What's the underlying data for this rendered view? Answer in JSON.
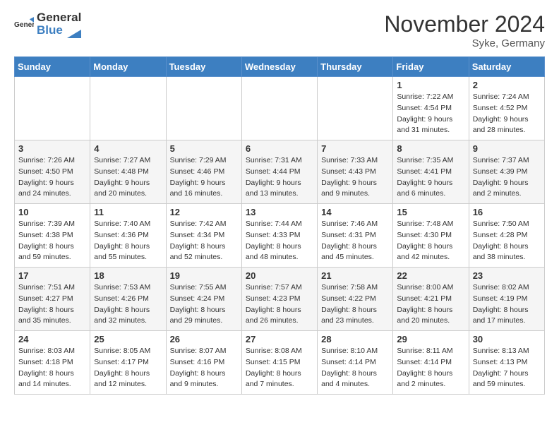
{
  "logo": {
    "general": "General",
    "blue": "Blue"
  },
  "header": {
    "title": "November 2024",
    "subtitle": "Syke, Germany"
  },
  "weekdays": [
    "Sunday",
    "Monday",
    "Tuesday",
    "Wednesday",
    "Thursday",
    "Friday",
    "Saturday"
  ],
  "weeks": [
    [
      {
        "day": "",
        "info": ""
      },
      {
        "day": "",
        "info": ""
      },
      {
        "day": "",
        "info": ""
      },
      {
        "day": "",
        "info": ""
      },
      {
        "day": "",
        "info": ""
      },
      {
        "day": "1",
        "info": "Sunrise: 7:22 AM\nSunset: 4:54 PM\nDaylight: 9 hours and 31 minutes."
      },
      {
        "day": "2",
        "info": "Sunrise: 7:24 AM\nSunset: 4:52 PM\nDaylight: 9 hours and 28 minutes."
      }
    ],
    [
      {
        "day": "3",
        "info": "Sunrise: 7:26 AM\nSunset: 4:50 PM\nDaylight: 9 hours and 24 minutes."
      },
      {
        "day": "4",
        "info": "Sunrise: 7:27 AM\nSunset: 4:48 PM\nDaylight: 9 hours and 20 minutes."
      },
      {
        "day": "5",
        "info": "Sunrise: 7:29 AM\nSunset: 4:46 PM\nDaylight: 9 hours and 16 minutes."
      },
      {
        "day": "6",
        "info": "Sunrise: 7:31 AM\nSunset: 4:44 PM\nDaylight: 9 hours and 13 minutes."
      },
      {
        "day": "7",
        "info": "Sunrise: 7:33 AM\nSunset: 4:43 PM\nDaylight: 9 hours and 9 minutes."
      },
      {
        "day": "8",
        "info": "Sunrise: 7:35 AM\nSunset: 4:41 PM\nDaylight: 9 hours and 6 minutes."
      },
      {
        "day": "9",
        "info": "Sunrise: 7:37 AM\nSunset: 4:39 PM\nDaylight: 9 hours and 2 minutes."
      }
    ],
    [
      {
        "day": "10",
        "info": "Sunrise: 7:39 AM\nSunset: 4:38 PM\nDaylight: 8 hours and 59 minutes."
      },
      {
        "day": "11",
        "info": "Sunrise: 7:40 AM\nSunset: 4:36 PM\nDaylight: 8 hours and 55 minutes."
      },
      {
        "day": "12",
        "info": "Sunrise: 7:42 AM\nSunset: 4:34 PM\nDaylight: 8 hours and 52 minutes."
      },
      {
        "day": "13",
        "info": "Sunrise: 7:44 AM\nSunset: 4:33 PM\nDaylight: 8 hours and 48 minutes."
      },
      {
        "day": "14",
        "info": "Sunrise: 7:46 AM\nSunset: 4:31 PM\nDaylight: 8 hours and 45 minutes."
      },
      {
        "day": "15",
        "info": "Sunrise: 7:48 AM\nSunset: 4:30 PM\nDaylight: 8 hours and 42 minutes."
      },
      {
        "day": "16",
        "info": "Sunrise: 7:50 AM\nSunset: 4:28 PM\nDaylight: 8 hours and 38 minutes."
      }
    ],
    [
      {
        "day": "17",
        "info": "Sunrise: 7:51 AM\nSunset: 4:27 PM\nDaylight: 8 hours and 35 minutes."
      },
      {
        "day": "18",
        "info": "Sunrise: 7:53 AM\nSunset: 4:26 PM\nDaylight: 8 hours and 32 minutes."
      },
      {
        "day": "19",
        "info": "Sunrise: 7:55 AM\nSunset: 4:24 PM\nDaylight: 8 hours and 29 minutes."
      },
      {
        "day": "20",
        "info": "Sunrise: 7:57 AM\nSunset: 4:23 PM\nDaylight: 8 hours and 26 minutes."
      },
      {
        "day": "21",
        "info": "Sunrise: 7:58 AM\nSunset: 4:22 PM\nDaylight: 8 hours and 23 minutes."
      },
      {
        "day": "22",
        "info": "Sunrise: 8:00 AM\nSunset: 4:21 PM\nDaylight: 8 hours and 20 minutes."
      },
      {
        "day": "23",
        "info": "Sunrise: 8:02 AM\nSunset: 4:19 PM\nDaylight: 8 hours and 17 minutes."
      }
    ],
    [
      {
        "day": "24",
        "info": "Sunrise: 8:03 AM\nSunset: 4:18 PM\nDaylight: 8 hours and 14 minutes."
      },
      {
        "day": "25",
        "info": "Sunrise: 8:05 AM\nSunset: 4:17 PM\nDaylight: 8 hours and 12 minutes."
      },
      {
        "day": "26",
        "info": "Sunrise: 8:07 AM\nSunset: 4:16 PM\nDaylight: 8 hours and 9 minutes."
      },
      {
        "day": "27",
        "info": "Sunrise: 8:08 AM\nSunset: 4:15 PM\nDaylight: 8 hours and 7 minutes."
      },
      {
        "day": "28",
        "info": "Sunrise: 8:10 AM\nSunset: 4:14 PM\nDaylight: 8 hours and 4 minutes."
      },
      {
        "day": "29",
        "info": "Sunrise: 8:11 AM\nSunset: 4:14 PM\nDaylight: 8 hours and 2 minutes."
      },
      {
        "day": "30",
        "info": "Sunrise: 8:13 AM\nSunset: 4:13 PM\nDaylight: 7 hours and 59 minutes."
      }
    ]
  ]
}
